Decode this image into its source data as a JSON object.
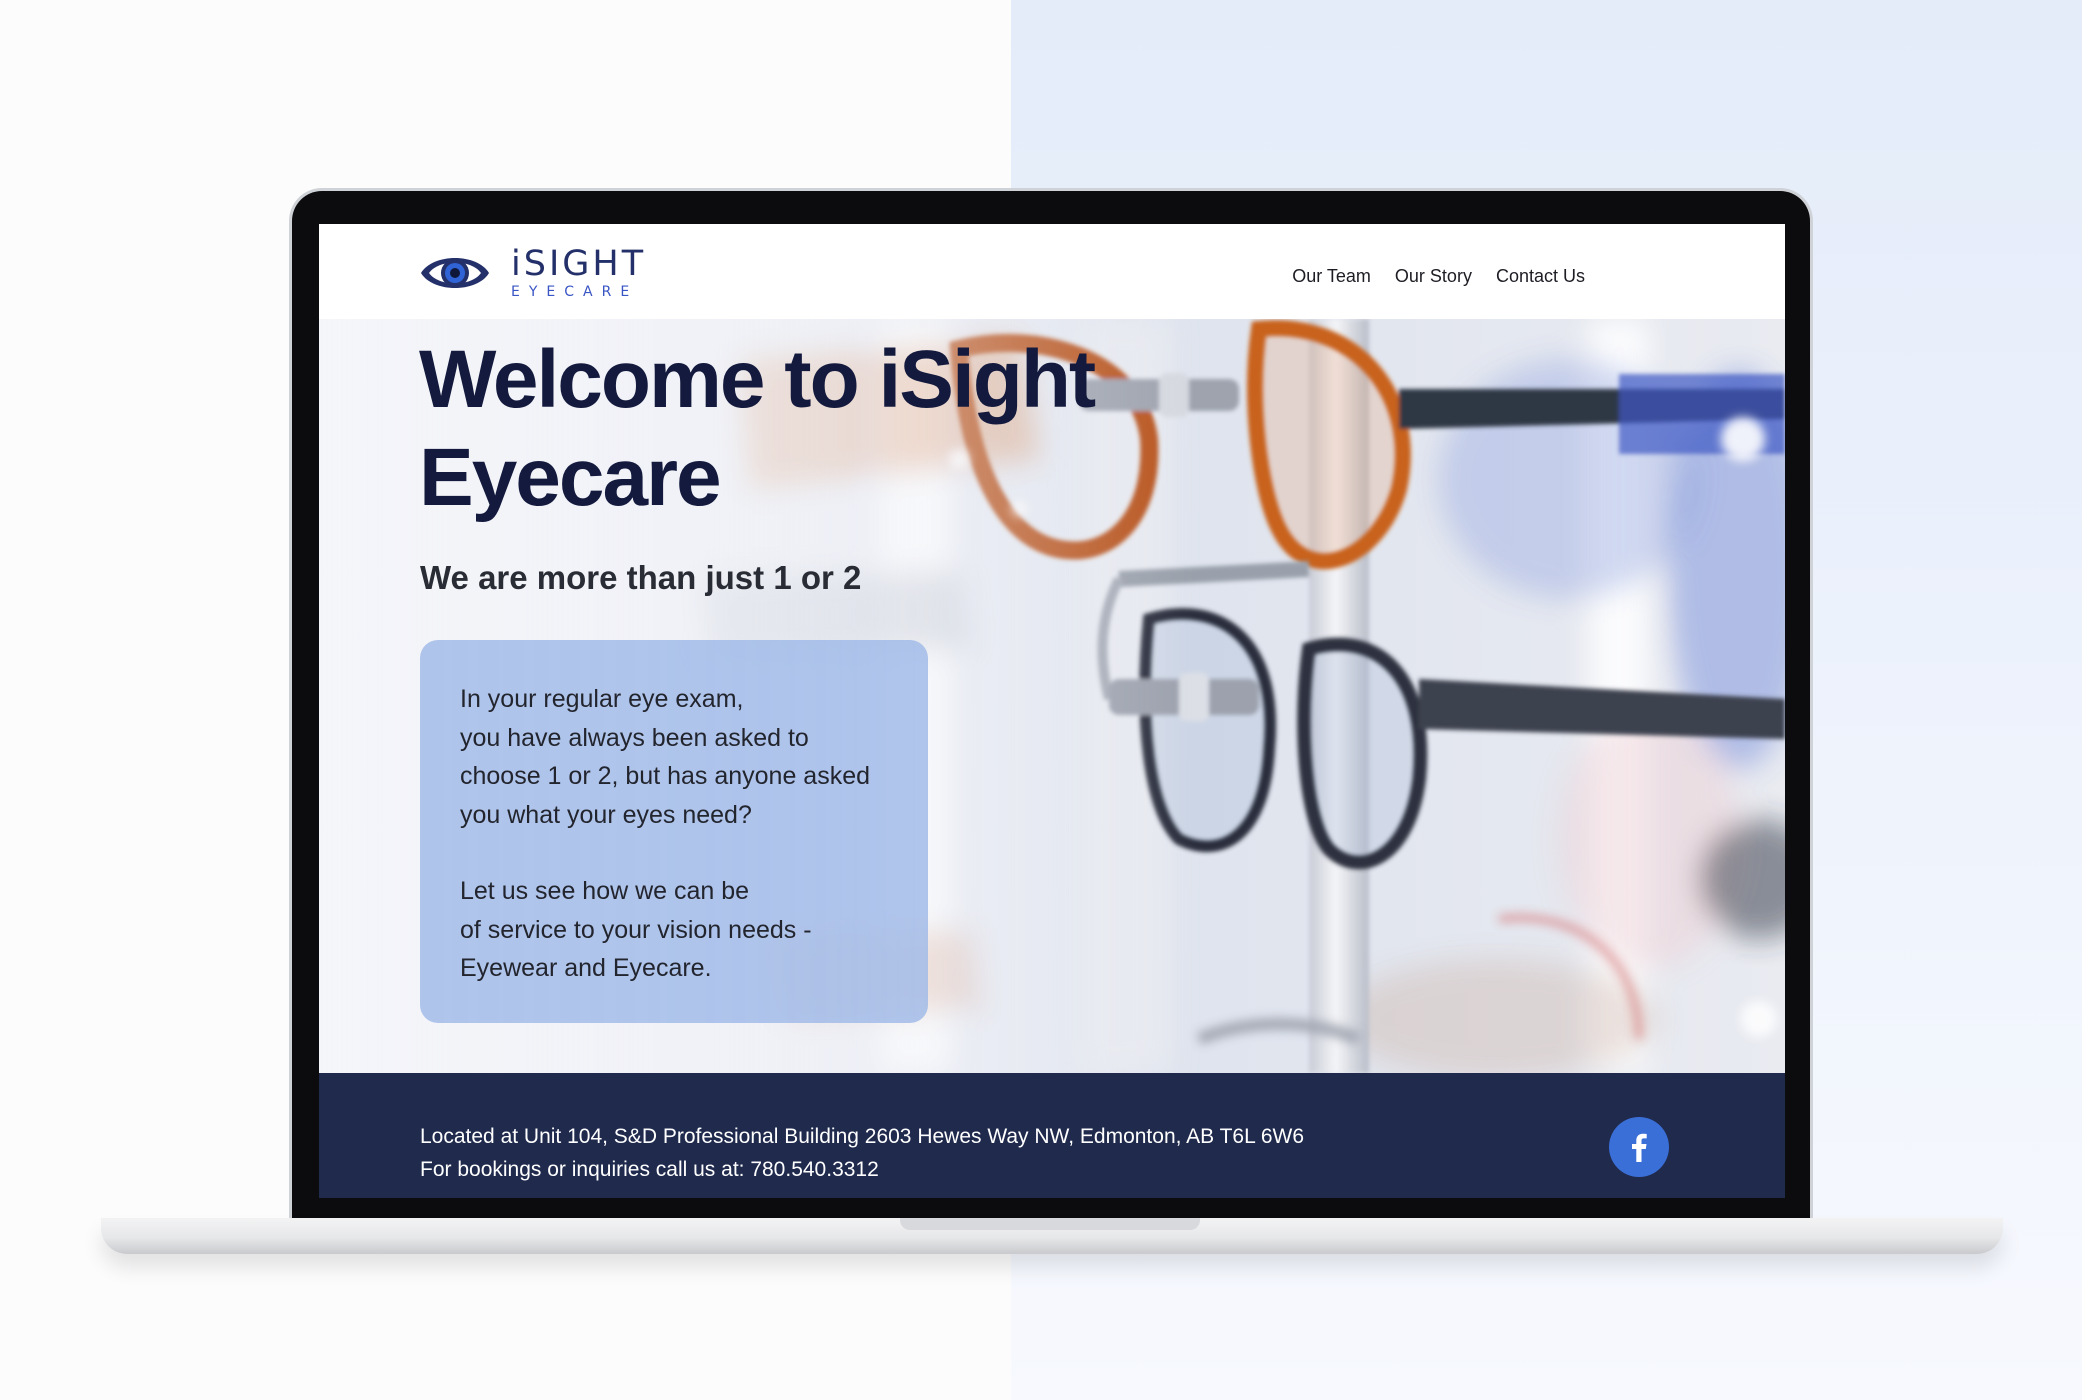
{
  "brand": {
    "name": "iSIGHT",
    "tagline": "EYECARE",
    "colors": {
      "primary": "#24306a",
      "accent": "#3a6fd8",
      "footer": "#1f2a4d"
    }
  },
  "nav": {
    "items": [
      {
        "label": "Our Team"
      },
      {
        "label": "Our Story"
      },
      {
        "label": "Contact Us"
      }
    ]
  },
  "hero": {
    "title": "Welcome to iSight Eyecare",
    "subtitle": "We are more than just 1 or 2",
    "card": {
      "paragraph1": "In your regular eye exam,\nyou have always been asked to\nchoose 1 or 2, but has anyone asked\nyou what your eyes need?",
      "paragraph2": "Let us see how we can be\nof service to your vision needs -\nEyewear and Eyecare."
    }
  },
  "footer": {
    "address": "Located at Unit 104, S&D Professional Building 2603 Hewes Way NW, Edmonton, AB T6L 6W6",
    "phone_line": "For bookings or inquiries call us at: 780.540.3312",
    "social_icon": "facebook-icon"
  }
}
